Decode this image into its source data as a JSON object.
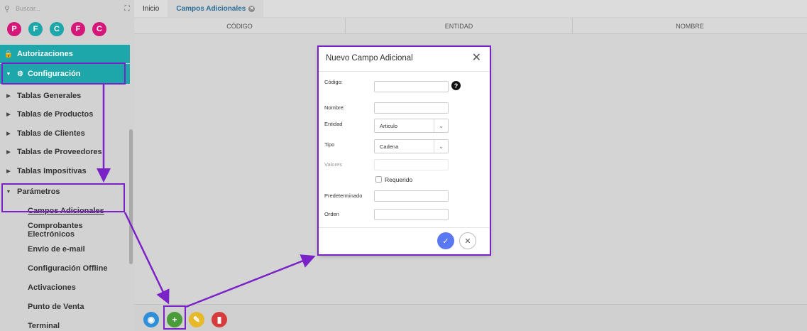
{
  "sidebar": {
    "search_placeholder": "Buscar...",
    "avatars": [
      {
        "letter": "P",
        "color": "#d6177a"
      },
      {
        "letter": "F",
        "color": "#1da7aa"
      },
      {
        "letter": "C",
        "color": "#1da7aa"
      },
      {
        "letter": "F",
        "color": "#d6177a"
      },
      {
        "letter": "C",
        "color": "#d6177a"
      }
    ],
    "items": {
      "autorizaciones": "Autorizaciones",
      "configuracion": "Configuración",
      "tablas_generales": "Tablas Generales",
      "tablas_productos": "Tablas de Productos",
      "tablas_clientes": "Tablas de Clientes",
      "tablas_proveedores": "Tablas de Proveedores",
      "tablas_impositivas": "Tablas Impositivas",
      "parametros": "Parámetros",
      "campos_adicionales": "Campos Adicionales",
      "comprobantes": "Comprobantes Electrónicos",
      "envio_email": "Envío de e-mail",
      "config_offline": "Configuración Offline",
      "activaciones": "Activaciones",
      "punto_venta": "Punto de Venta",
      "terminal": "Terminal"
    }
  },
  "tabs": {
    "inicio": "Inicio",
    "campos": "Campos Adicionales"
  },
  "columns": {
    "codigo": "CÓDIGO",
    "entidad": "ENTIDAD",
    "nombre": "NOMBRE"
  },
  "modal": {
    "title": "Nuevo Campo Adicional",
    "codigo_label": "Código:",
    "nombre_label": "Nombre:",
    "entidad_label": "Entidad",
    "entidad_value": "Articulo",
    "tipo_label": "Tipo",
    "tipo_value": "Cadena",
    "valores_label": "Valores",
    "requerido_label": "Requerido",
    "predeterminado_label": "Predeterminado",
    "orden_label": "Orden"
  },
  "colors": {
    "accent": "#1da7aa",
    "annotation": "#7a22c7",
    "confirm": "#5a78f0"
  },
  "icons": [
    "search-icon",
    "expand-icon",
    "lock-icon",
    "gears-icon",
    "caret-right-icon",
    "caret-down-icon",
    "close-icon",
    "help-icon",
    "chevron-down-icon",
    "check-icon",
    "eye-icon",
    "plus-icon",
    "pencil-icon",
    "trash-icon"
  ]
}
